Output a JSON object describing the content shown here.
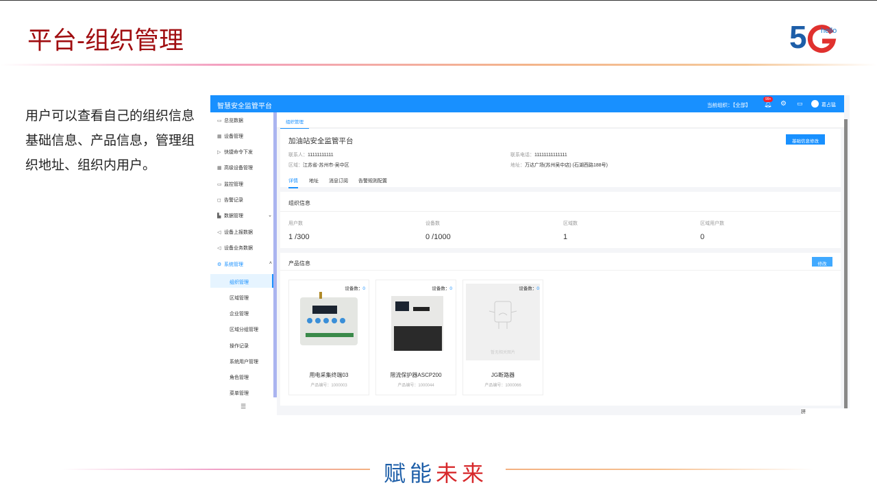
{
  "slide": {
    "title": "平台-组织管理",
    "description": "用户可以查看自己的组织信息基础信息、产品信息，管理组织地址、组织内用户。",
    "footer_blue": "赋能",
    "footer_red": "未来",
    "logo_text": "5G hello"
  },
  "app": {
    "title": "智慧安全监管平台",
    "current_org_label": "当前组织：【全部】",
    "badge": "99+",
    "username": "葛占猛",
    "sidebar": [
      {
        "label": "总览数据",
        "icon": "monitor-icon"
      },
      {
        "label": "设备管理",
        "icon": "grid-icon"
      },
      {
        "label": "快捷命令下发",
        "icon": "send-icon"
      },
      {
        "label": "高级设备管理",
        "icon": "grid-icon"
      },
      {
        "label": "监控管理",
        "icon": "video-icon"
      },
      {
        "label": "告警记录",
        "icon": "alarm-icon"
      },
      {
        "label": "数据管理",
        "icon": "chart-icon"
      },
      {
        "label": "设备上报数据",
        "icon": "megaphone-icon"
      },
      {
        "label": "设备业务数据",
        "icon": "megaphone-icon"
      },
      {
        "label": "系统管理",
        "icon": "gear-icon"
      }
    ],
    "submenu": [
      "组织管理",
      "区域管理",
      "企业管理",
      "区域分组管理",
      "操作记录",
      "系统用户管理",
      "角色管理",
      "菜单管理"
    ],
    "tab": "组织管理",
    "org": {
      "name": "加油站安全监管平台",
      "edit_button": "基础信息修改",
      "contact_label": "联系人：",
      "contact": "11111111111",
      "phone_label": "联系电话：",
      "phone": "11111111111111",
      "region_label": "区域：",
      "region": "江苏省-苏州市-吴中区",
      "address_label": "地址：",
      "address": "万达广场(苏州吴中店) (石湖西路188号)"
    },
    "subtabs": [
      "详情",
      "地址",
      "消息订阅",
      "告警规则配置"
    ],
    "org_info": {
      "title": "组织信息",
      "stats": [
        {
          "label": "用户数",
          "value": "1 /300"
        },
        {
          "label": "设备数",
          "value": "0 /1000"
        },
        {
          "label": "区域数",
          "value": "1"
        },
        {
          "label": "区域用户数",
          "value": "0"
        }
      ]
    },
    "products": {
      "title": "产品信息",
      "edit_button": "修改",
      "count_label": "设备数：",
      "code_label": "产品编号：",
      "no_image": "暂无相关图片",
      "items": [
        {
          "name": "用电采集终端03",
          "count": "0",
          "code": "1000003"
        },
        {
          "name": "限流保护器ASCP200",
          "count": "0",
          "code": "1000044"
        },
        {
          "name": "JG断路器",
          "count": "0",
          "code": "1000066"
        }
      ]
    },
    "ime": "拼"
  }
}
